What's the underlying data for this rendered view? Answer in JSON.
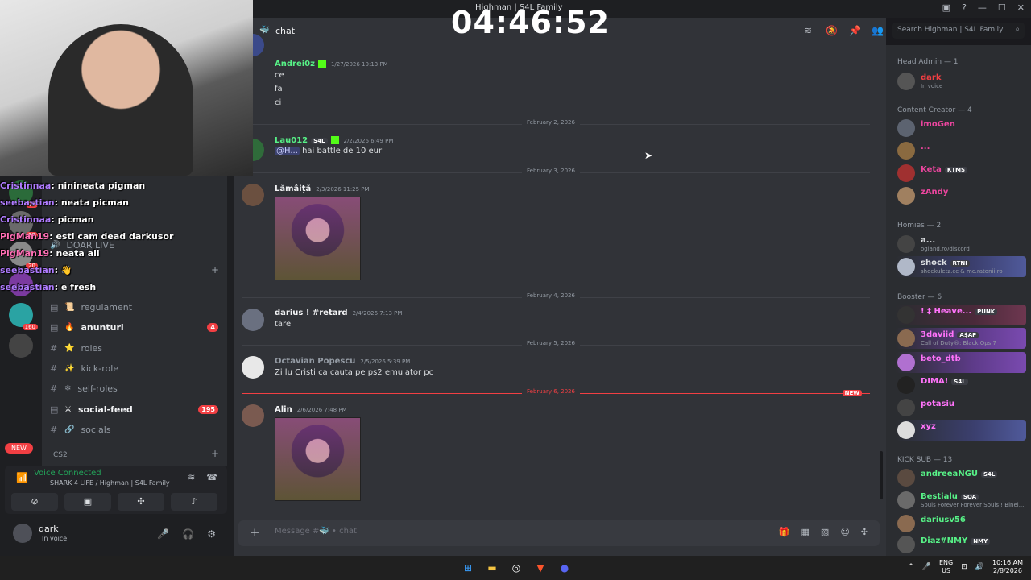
{
  "window": {
    "title": "Highman | S4L Family",
    "controls": [
      "—",
      "☐",
      "✕"
    ]
  },
  "stream_timer": "04:46:52",
  "chat_header": {
    "channel": "chat",
    "search_placeholder": "Search Highman | S4L Family"
  },
  "overlay_chat": [
    {
      "user": "Cristinnaa",
      "text": "ninineata pigman",
      "style": ""
    },
    {
      "user": "seebastian",
      "text": "neata picman",
      "style": ""
    },
    {
      "user": "Cristinnaa",
      "text": "picman",
      "style": ""
    },
    {
      "user": "PigMan19",
      "text": "esti cam dead darkusor",
      "style": "pink"
    },
    {
      "user": "PigMan19",
      "text": "neata all",
      "style": "pink"
    },
    {
      "user": "seebastian",
      "text": "👋",
      "style": ""
    },
    {
      "user": "seebastian",
      "text": "e fresh",
      "style": ""
    }
  ],
  "server_rail": {
    "badges": [
      "98",
      "37",
      "20",
      "160"
    ],
    "new_label": "NEW"
  },
  "channels": {
    "stage": "DOAR LIVE",
    "list": [
      {
        "label": "regulament",
        "icon": "📜",
        "bold": false,
        "badge": ""
      },
      {
        "label": "anunturi",
        "icon": "🔥",
        "bold": true,
        "badge": "4"
      },
      {
        "label": "roles",
        "icon": "⭐",
        "bold": false,
        "badge": ""
      },
      {
        "label": "kick-role",
        "icon": "✨",
        "bold": false,
        "badge": ""
      },
      {
        "label": "self-roles",
        "icon": "❄",
        "bold": false,
        "badge": ""
      },
      {
        "label": "social-feed",
        "icon": "⚔",
        "bold": true,
        "badge": "195"
      },
      {
        "label": "socials",
        "icon": "🔗",
        "bold": false,
        "badge": ""
      }
    ],
    "category": "CS2"
  },
  "voice": {
    "status": "Voice Connected",
    "location": "SHARK 4 LIFE / Highman | S4L Family"
  },
  "user": {
    "name": "dark",
    "status": "In voice"
  },
  "messages": [
    {
      "user": "Andrei0z",
      "color": "#57f287",
      "time": "1/27/2026 10:13 PM",
      "lines": [
        "ce",
        "fa",
        "ci"
      ]
    },
    {
      "divider": "February 2, 2026"
    },
    {
      "user": "Lau012",
      "color": "#57f287",
      "tag": "S4L",
      "time": "2/2/2026 6:49 PM",
      "mention": "@H...",
      "text": "hai battle de 10 eur"
    },
    {
      "divider": "February 3, 2026"
    },
    {
      "user": "Lămâiță",
      "color": "#f2f3f5",
      "time": "2/3/2026 11:25 PM"
    },
    {
      "divider": "February 4, 2026"
    },
    {
      "user": "darius ! #retard",
      "color": "#f2f3f5",
      "time": "2/4/2026 7:13 PM",
      "text": "tare"
    },
    {
      "divider": "February 5, 2026"
    },
    {
      "user": "Octavian Popescu",
      "color": "#949ba4",
      "time": "2/5/2026 5:39 PM",
      "text": "Zi lu Cristi ca cauta pe ps2 emulator pc"
    },
    {
      "divider": "February 6, 2026",
      "new": "NEW"
    },
    {
      "user": "Alin",
      "color": "#f2f3f5",
      "time": "2/6/2026 7:48 PM"
    }
  ],
  "input": {
    "placeholder": "Message #🐳 • chat"
  },
  "members": {
    "head_admin": "Head Admin — 1",
    "content_creator": "Content Creator — 4",
    "homies": "Homies — 2",
    "booster": "Booster — 6",
    "kick_sub": "KICK SUB — 13",
    "list": [
      {
        "name": "dark",
        "sub": "In voice",
        "color": "#f23f43"
      },
      {
        "name": "imoGen",
        "sub": "",
        "color": "#eb459e"
      },
      {
        "name": "...",
        "sub": "",
        "color": "#eb459e"
      },
      {
        "name": "Keta",
        "sub": "",
        "color": "#eb459e",
        "tag": "KTMS"
      },
      {
        "name": "zAndy",
        "sub": "",
        "color": "#eb459e"
      },
      {
        "name": "a...",
        "sub": "ogland.ro/discord",
        "color": "#dbdee1"
      },
      {
        "name": "shock",
        "sub": "shockuletz.cc & mc.ratonii.ro",
        "color": "#dbdee1",
        "tag": "RTNI"
      },
      {
        "name": "! ‡ Heave...",
        "sub": "",
        "color": "#ff73fa",
        "tag": "PUNK"
      },
      {
        "name": "3daviid",
        "sub": "Call of Duty®: Black Ops 7",
        "color": "#ff73fa",
        "tag": "A$AP"
      },
      {
        "name": "beto_dtb",
        "sub": "",
        "color": "#ff73fa"
      },
      {
        "name": "DIMA!",
        "sub": "",
        "color": "#ff73fa",
        "tag": "S4L"
      },
      {
        "name": "potasiu",
        "sub": "",
        "color": "#ff73fa"
      },
      {
        "name": "xyz",
        "sub": "",
        "color": "#ff73fa"
      },
      {
        "name": "andreeaNGU",
        "sub": "",
        "color": "#57f287",
        "tag": "S4L"
      },
      {
        "name": "Bestialu",
        "sub": "Souls Forever Forever Souls ! Binel...",
        "color": "#57f287",
        "tag": "SOA"
      },
      {
        "name": "dariusv56",
        "sub": "",
        "color": "#57f287"
      },
      {
        "name": "Diaz#NMY",
        "sub": "",
        "color": "#57f287",
        "tag": "NMY"
      }
    ]
  },
  "taskbar": {
    "lang": "ENG",
    "region": "US",
    "time": "10:16 AM",
    "date": "2/8/2026"
  }
}
